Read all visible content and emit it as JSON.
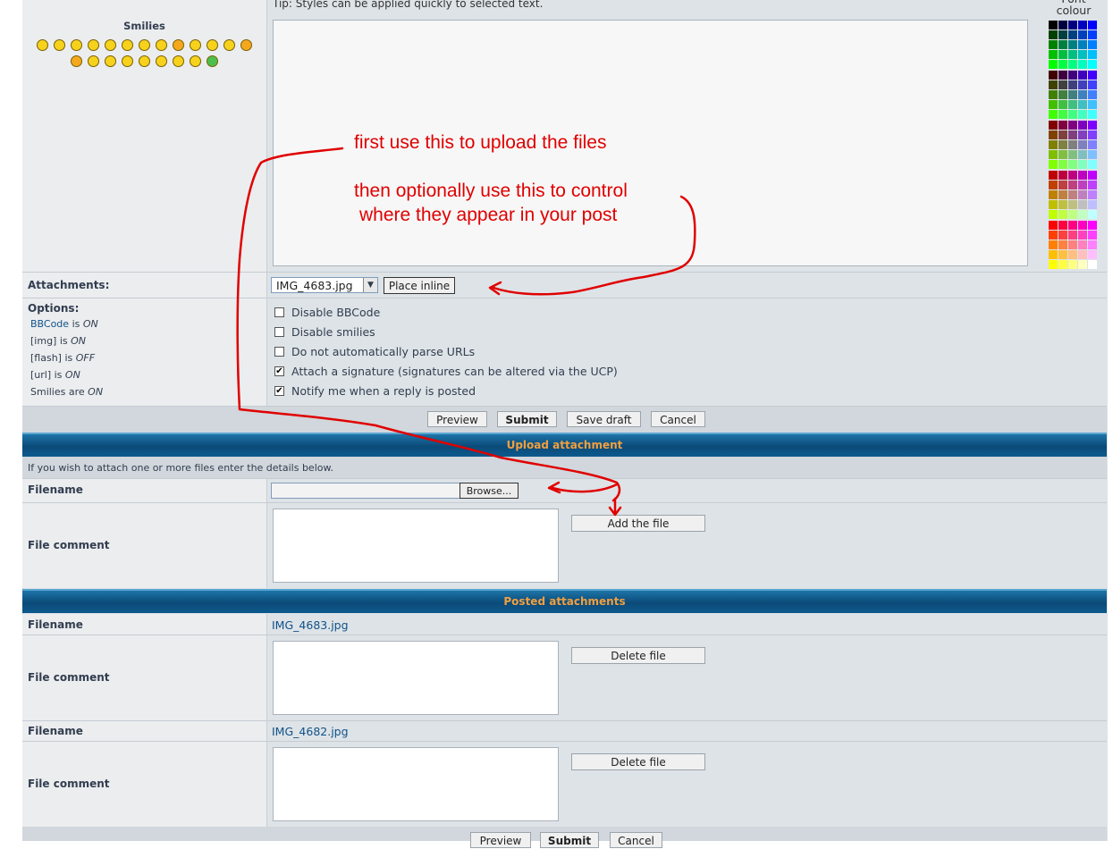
{
  "tip_text": "Tip: Styles can be applied quickly to selected text.",
  "smilies": {
    "title": "Smilies",
    "icons": [
      "grin",
      "smile",
      "sad",
      "surprised",
      "eek",
      "confused",
      "cool",
      "laughing",
      "mad",
      "razz",
      "embarassed",
      "cry",
      "evil",
      "twisted-evil",
      "rolleyes",
      "wink",
      "exclaim",
      "question",
      "idea",
      "arrow",
      "neutral",
      "mr-green"
    ]
  },
  "font_colour": {
    "title": "Font colour"
  },
  "annotations": {
    "line1": "first use this to upload the files",
    "line2": "then optionally use this to control",
    "line3": "where they appear in your post"
  },
  "attachments": {
    "label": "Attachments:",
    "selected_file": "IMG_4683.jpg",
    "place_inline_button": "Place inline"
  },
  "options": {
    "label": "Options:",
    "bbcode_link": "BBCode",
    "is_text": "is",
    "bbcode_state": "ON",
    "img_label": "[img] is",
    "img_state": "ON",
    "flash_label": "[flash] is",
    "flash_state": "OFF",
    "url_label": "[url] is",
    "url_state": "ON",
    "smilies_label": "Smilies are",
    "smilies_state": "ON",
    "checkboxes": [
      {
        "label": "Disable BBCode",
        "checked": false
      },
      {
        "label": "Disable smilies",
        "checked": false
      },
      {
        "label": "Do not automatically parse URLs",
        "checked": false
      },
      {
        "label": "Attach a signature (signatures can be altered via the UCP)",
        "checked": true
      },
      {
        "label": "Notify me when a reply is posted",
        "checked": true
      }
    ]
  },
  "buttons": {
    "preview": "Preview",
    "submit": "Submit",
    "save_draft": "Save draft",
    "cancel": "Cancel"
  },
  "upload": {
    "header": "Upload attachment",
    "description": "If you wish to attach one or more files enter the details below.",
    "filename_label": "Filename",
    "browse_button": "Browse...",
    "file_comment_label": "File comment",
    "add_file_button": "Add the file"
  },
  "posted": {
    "header": "Posted attachments",
    "items": [
      {
        "filename_label": "Filename",
        "filename": "IMG_4683.jpg",
        "comment_label": "File comment",
        "delete_button": "Delete file"
      },
      {
        "filename_label": "Filename",
        "filename": "IMG_4682.jpg",
        "comment_label": "File comment",
        "delete_button": "Delete file"
      }
    ]
  },
  "bottom_buttons": {
    "preview": "Preview",
    "submit": "Submit",
    "cancel": "Cancel"
  }
}
